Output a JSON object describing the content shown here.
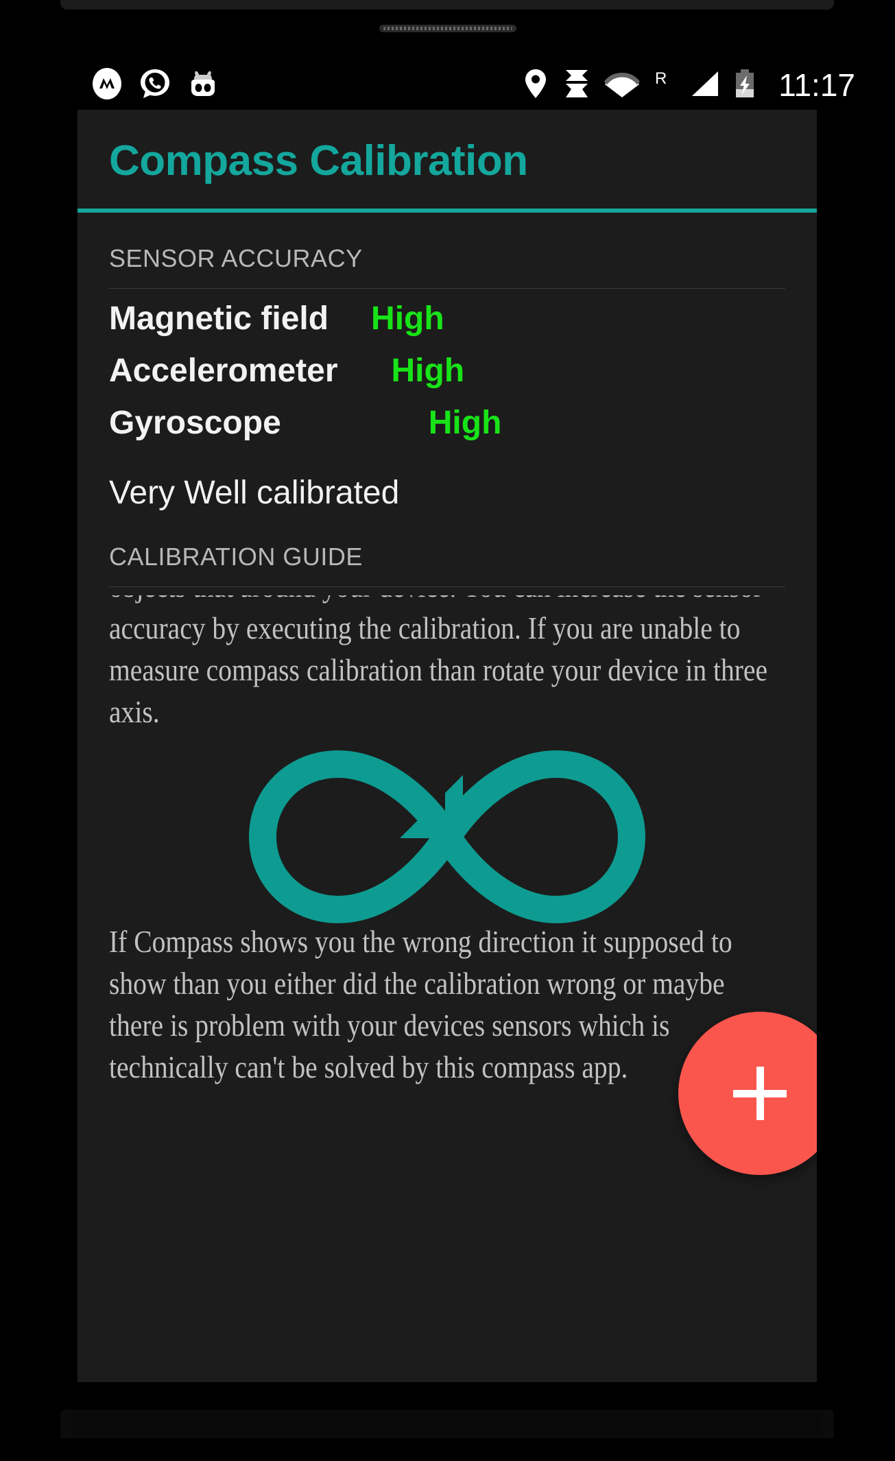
{
  "status_bar": {
    "left_icons": [
      {
        "name": "messenger-icon",
        "glyph": "M"
      },
      {
        "name": "whatsapp-icon",
        "glyph": "phone"
      },
      {
        "name": "cyanogenmod-icon",
        "glyph": "android-head"
      }
    ],
    "right_icons": [
      {
        "name": "location-pin-icon"
      },
      {
        "name": "bowtie-icon"
      },
      {
        "name": "wifi-icon"
      },
      {
        "name": "roaming-icon",
        "label": "R"
      },
      {
        "name": "signal-bars-icon"
      },
      {
        "name": "battery-charging-icon"
      }
    ],
    "roaming_label": "R",
    "time": "11:17"
  },
  "app": {
    "title": "Compass Calibration",
    "accent_color": "#14a79d",
    "background_color": "#1c1c1c"
  },
  "sensor_accuracy": {
    "header": "SENSOR ACCURACY",
    "rows": [
      {
        "name": "Magnetic field",
        "value": "High"
      },
      {
        "name": "Accelerometer",
        "value": "High"
      },
      {
        "name": "Gyroscope",
        "value": "High"
      }
    ],
    "value_color": "#18e318",
    "status": "Very Well calibrated"
  },
  "calibration_guide": {
    "header": "CALIBRATION GUIDE",
    "paragraph_top": "objects that around your device. You can increase the sensor accuracy by executing the calibration. If you are unable to measure compass calibration than rotate your device in three axis.",
    "figure": {
      "name": "infinity-motion-icon",
      "color": "#14a79d"
    },
    "paragraph_bottom": "If Compass shows you the wrong direction it supposed to show than you either did the calibration wrong or maybe there is problem with your devices sensors which is technically can't be solved by this compass app."
  },
  "fab": {
    "name": "add-button",
    "label": "+",
    "color": "#fa564d"
  }
}
